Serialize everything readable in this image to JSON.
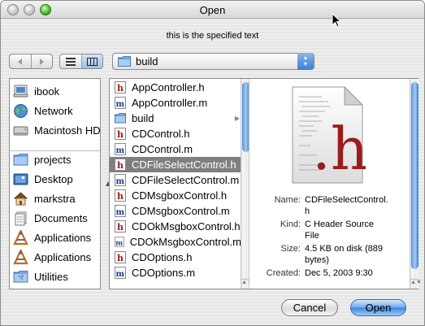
{
  "window": {
    "title": "Open",
    "prompt": "this is the specified text"
  },
  "toolbar": {
    "back_icon": "back-arrow-icon",
    "forward_icon": "forward-arrow-icon",
    "list_view_icon": "list-view-icon",
    "column_view_icon": "column-view-icon",
    "path_popup_label": "build"
  },
  "sidebar": {
    "devices": [
      {
        "label": "ibook",
        "icon": "computer-icon"
      },
      {
        "label": "Network",
        "icon": "globe-icon"
      },
      {
        "label": "Macintosh HD",
        "icon": "hard-drive-icon"
      }
    ],
    "places": [
      {
        "label": "projects",
        "icon": "folder-icon"
      },
      {
        "label": "Desktop",
        "icon": "desktop-icon"
      },
      {
        "label": "markstra",
        "icon": "home-icon"
      },
      {
        "label": "Documents",
        "icon": "documents-icon"
      },
      {
        "label": "Applications",
        "icon": "applications-icon"
      },
      {
        "label": "Applications",
        "icon": "applications-icon"
      },
      {
        "label": "Utilities",
        "icon": "folder-icon"
      }
    ]
  },
  "files": [
    {
      "name": "AppController.h",
      "kind": "h"
    },
    {
      "name": "AppController.m",
      "kind": "m"
    },
    {
      "name": "build",
      "kind": "folder"
    },
    {
      "name": "CDControl.h",
      "kind": "h"
    },
    {
      "name": "CDControl.m",
      "kind": "m"
    },
    {
      "name": "CDFileSelectControl.h",
      "kind": "h",
      "selected": true
    },
    {
      "name": "CDFileSelectControl.m",
      "kind": "m"
    },
    {
      "name": "CDMsgboxControl.h",
      "kind": "h"
    },
    {
      "name": "CDMsgboxControl.m",
      "kind": "m"
    },
    {
      "name": "CDOkMsgboxControl.h",
      "kind": "h"
    },
    {
      "name": "CDOkMsgboxControl.m",
      "kind": "m"
    },
    {
      "name": "CDOptions.h",
      "kind": "h"
    },
    {
      "name": "CDOptions.m",
      "kind": "m"
    }
  ],
  "preview": {
    "icon": "header-file-icon",
    "icon_letter": ".h",
    "name_label": "Name:",
    "name_value_1": "CDFileSelectControl.",
    "name_value_2": "h",
    "kind_label": "Kind:",
    "kind_value_1": "C Header Source",
    "kind_value_2": "File",
    "size_label": "Size:",
    "size_value_1": "4.5 KB on disk (889",
    "size_value_2": "bytes)",
    "created_label": "Created:",
    "created_value": "Dec 5, 2003 9:30"
  },
  "buttons": {
    "cancel": "Cancel",
    "open": "Open"
  },
  "colors": {
    "header_h_accent": "#9b1c1c",
    "source_m_accent": "#1f3a8a",
    "selection": "#7f7f7f",
    "aqua_blue": "#3d86e0"
  }
}
